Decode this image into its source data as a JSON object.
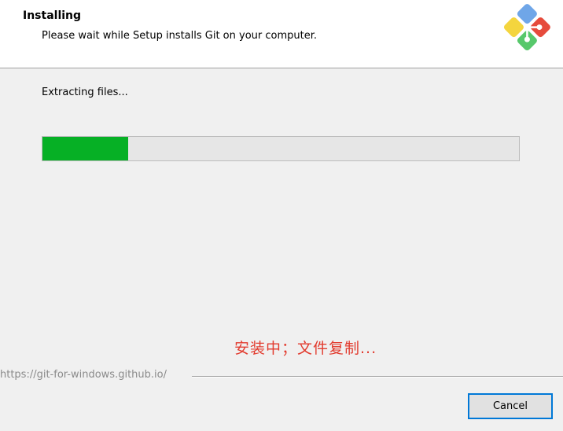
{
  "header": {
    "title": "Installing",
    "subtitle": "Please wait while Setup installs Git on your computer.",
    "logo_icon": "git-logo-icon"
  },
  "main": {
    "status_text": "Extracting files...",
    "progress": {
      "percent": 18,
      "fill_color": "#06b025"
    },
    "annotation": "安装中；文件复制..."
  },
  "footer": {
    "link_text": "https://git-for-windows.github.io/",
    "cancel_label": "Cancel"
  }
}
